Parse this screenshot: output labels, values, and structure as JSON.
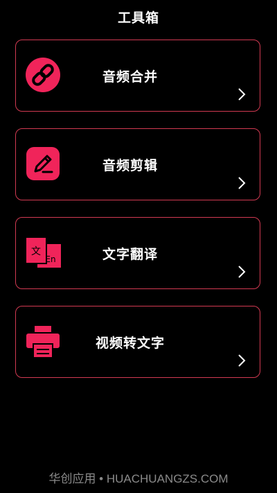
{
  "header": {
    "title": "工具箱"
  },
  "tools": [
    {
      "label": "音频合并",
      "icon": "link-icon",
      "action_icon": "chevron-right-icon"
    },
    {
      "label": "音频剪辑",
      "icon": "edit-icon",
      "action_icon": "chevron-right-icon"
    },
    {
      "label": "文字翻译",
      "icon": "translate-icon",
      "icon_text_1": "文",
      "icon_text_2": "En",
      "action_icon": "chevron-right-icon"
    },
    {
      "label": "视频转文字",
      "icon": "printer-icon",
      "action_icon": "chevron-right-icon"
    }
  ],
  "watermark": "华创应用 • HUACHUANGZS.COM",
  "colors": {
    "background": "#000000",
    "accent": "#f0245a",
    "border": "#d23a52",
    "text": "#ffffff"
  }
}
